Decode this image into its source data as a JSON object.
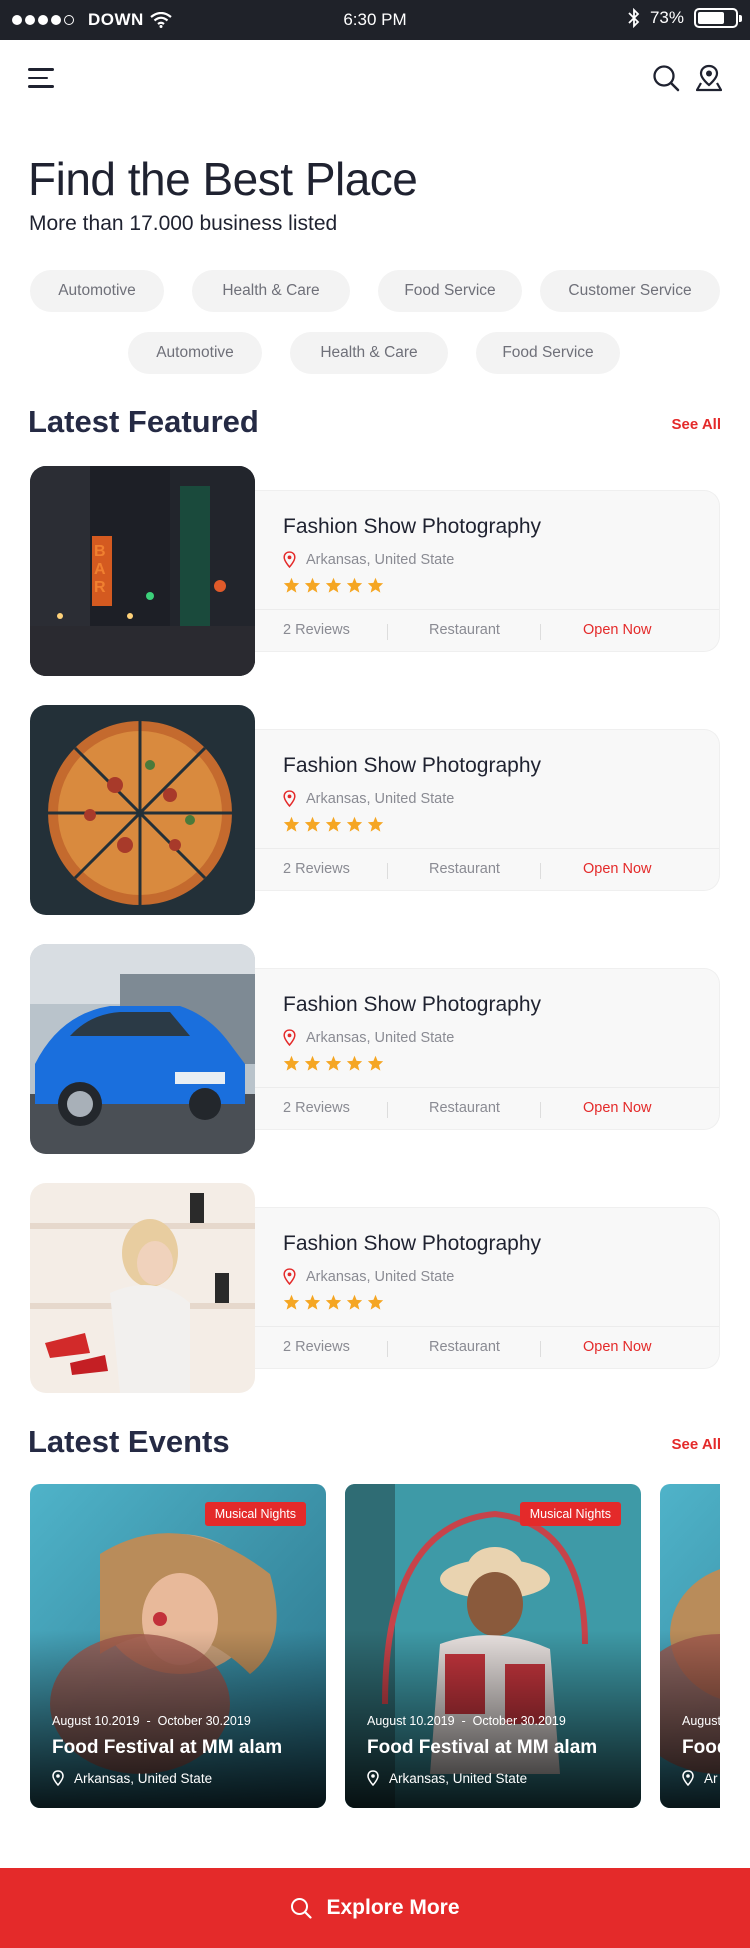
{
  "status_bar": {
    "carrier": "DOWN",
    "time": "6:30 PM",
    "battery": "73%",
    "battery_level": 0.73
  },
  "hero": {
    "title": "Find the Best Place",
    "subtitle": "More than 17.000 business listed"
  },
  "categories_row1": [
    "Automotive",
    "Health & Care",
    "Food Service",
    "Customer Service"
  ],
  "categories_row2": [
    "Automotive",
    "Health & Care",
    "Food Service"
  ],
  "featured": {
    "title": "Latest Featured",
    "see_all": "See All",
    "items": [
      {
        "title": "Fashion Show Photography",
        "location": "Arkansas, United State",
        "rating": 5,
        "reviews": "2 Reviews",
        "category": "Restaurant",
        "status": "Open Now",
        "image": "city-night"
      },
      {
        "title": "Fashion Show Photography",
        "location": "Arkansas, United State",
        "rating": 5,
        "reviews": "2 Reviews",
        "category": "Restaurant",
        "status": "Open Now",
        "image": "pizza"
      },
      {
        "title": "Fashion Show Photography",
        "location": "Arkansas, United State",
        "rating": 5,
        "reviews": "2 Reviews",
        "category": "Restaurant",
        "status": "Open Now",
        "image": "blue-car"
      },
      {
        "title": "Fashion Show Photography",
        "location": "Arkansas, United State",
        "rating": 5,
        "reviews": "2 Reviews",
        "category": "Restaurant",
        "status": "Open Now",
        "image": "shoe-store"
      }
    ]
  },
  "events": {
    "title": "Latest Events",
    "see_all": "See All",
    "items": [
      {
        "badge": "Musical Nights",
        "start_date": "August 10.2019",
        "end_date": "October 30.2019",
        "date_sep": "-",
        "title": "Food Festival at MM alam",
        "location": "Arkansas, United State"
      },
      {
        "badge": "Musical Nights",
        "start_date": "August 10.2019",
        "end_date": "October 30.2019",
        "date_sep": "-",
        "title": "Food Festival at MM alam",
        "location": "Arkansas, United State"
      },
      {
        "badge": "",
        "start_date": "August",
        "end_date": "",
        "date_sep": "",
        "title": "Food",
        "location": "Ar"
      }
    ]
  },
  "footer": {
    "button_label": "Explore More"
  },
  "colors": {
    "accent": "#e42a2a",
    "star": "#f5a623",
    "heading": "#252a44",
    "status_bar": "#1f2229"
  }
}
